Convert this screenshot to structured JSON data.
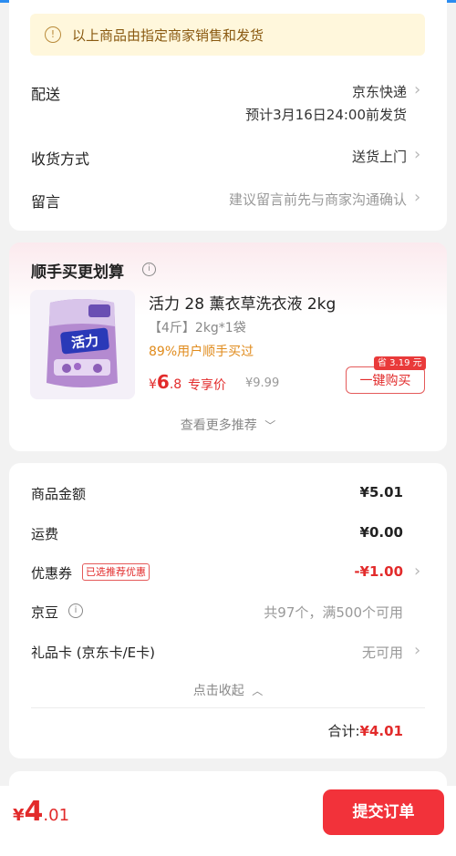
{
  "notice": {
    "text": "以上商品由指定商家销售和发货"
  },
  "delivery": {
    "label": "配送",
    "carrier": "京东快递",
    "estimate": "预计3月16日24:00前发货"
  },
  "receive": {
    "label": "收货方式",
    "value": "送货上门"
  },
  "message": {
    "label": "留言",
    "placeholder": "建议留言前先与商家沟通确认"
  },
  "recommend": {
    "title": "顺手买更划算",
    "product": {
      "name": "活力 28 薰衣草洗衣液 2kg",
      "spec": "【4斤】2kg*1袋",
      "bought": "89%用户顺手买过",
      "price_symbol": "¥",
      "price_int": "6",
      "price_dec": ".8",
      "exclusive": "专享价",
      "original": "¥9.99",
      "save_badge": "省 3.19 元",
      "buy_label": "一键购买"
    },
    "more": "查看更多推荐"
  },
  "costs": {
    "goods": {
      "label": "商品金额",
      "value": "¥5.01"
    },
    "shipping": {
      "label": "运费",
      "value": "¥0.00"
    },
    "coupon": {
      "label": "优惠券",
      "tag": "已选推荐优惠",
      "value": "-¥1.00"
    },
    "jingdou": {
      "label": "京豆",
      "value": "共97个，满500个可用"
    },
    "giftcard": {
      "label": "礼品卡 (京东卡/E卡)",
      "value": "无可用"
    },
    "collapse": "点击收起",
    "total_label": "合计:",
    "total_value": "¥4.01"
  },
  "bottom": {
    "price_symbol": "¥",
    "price_int": "4",
    "price_dec": ".01",
    "submit": "提交订单"
  },
  "colors": {
    "accent": "#f2323a",
    "price": "#e22b2b",
    "notice_bg": "#fff7dc"
  }
}
